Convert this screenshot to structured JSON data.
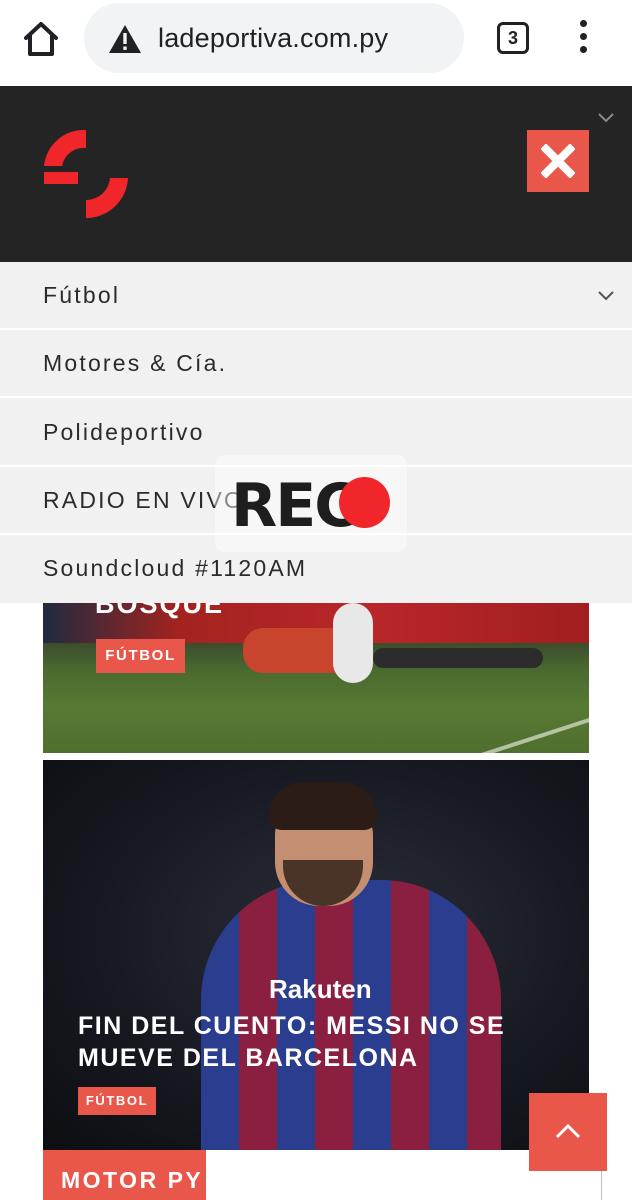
{
  "browser": {
    "url": "ladeportiva.com.py",
    "tab_count": "3",
    "icons": [
      "home-icon",
      "warning-icon",
      "tabs-icon",
      "more-vert-icon"
    ]
  },
  "site": {
    "brand_color": "#e9564a",
    "header_bg": "#242424",
    "menu_items": [
      {
        "label": "Fútbol",
        "has_submenu": true
      },
      {
        "label": "Motores & Cía.",
        "has_submenu": false
      },
      {
        "label": "Polideportivo",
        "has_submenu": false
      },
      {
        "label": "RADIO EN VIVO",
        "has_submenu": false
      },
      {
        "label": "Soundcloud #1120AM",
        "has_submenu": false
      }
    ]
  },
  "overlay": {
    "rec_label": "REC",
    "rec_dot_color": "#f0262a"
  },
  "articles": [
    {
      "title": "BOSQUE",
      "category": "FÚTBOL"
    },
    {
      "title": "FIN DEL CUENTO: MESSI NO SE MUEVE DEL BARCELONA",
      "category": "FÚTBOL",
      "image_text": "Rakuten"
    }
  ],
  "section_tab": {
    "label": "MOTOR PY"
  }
}
